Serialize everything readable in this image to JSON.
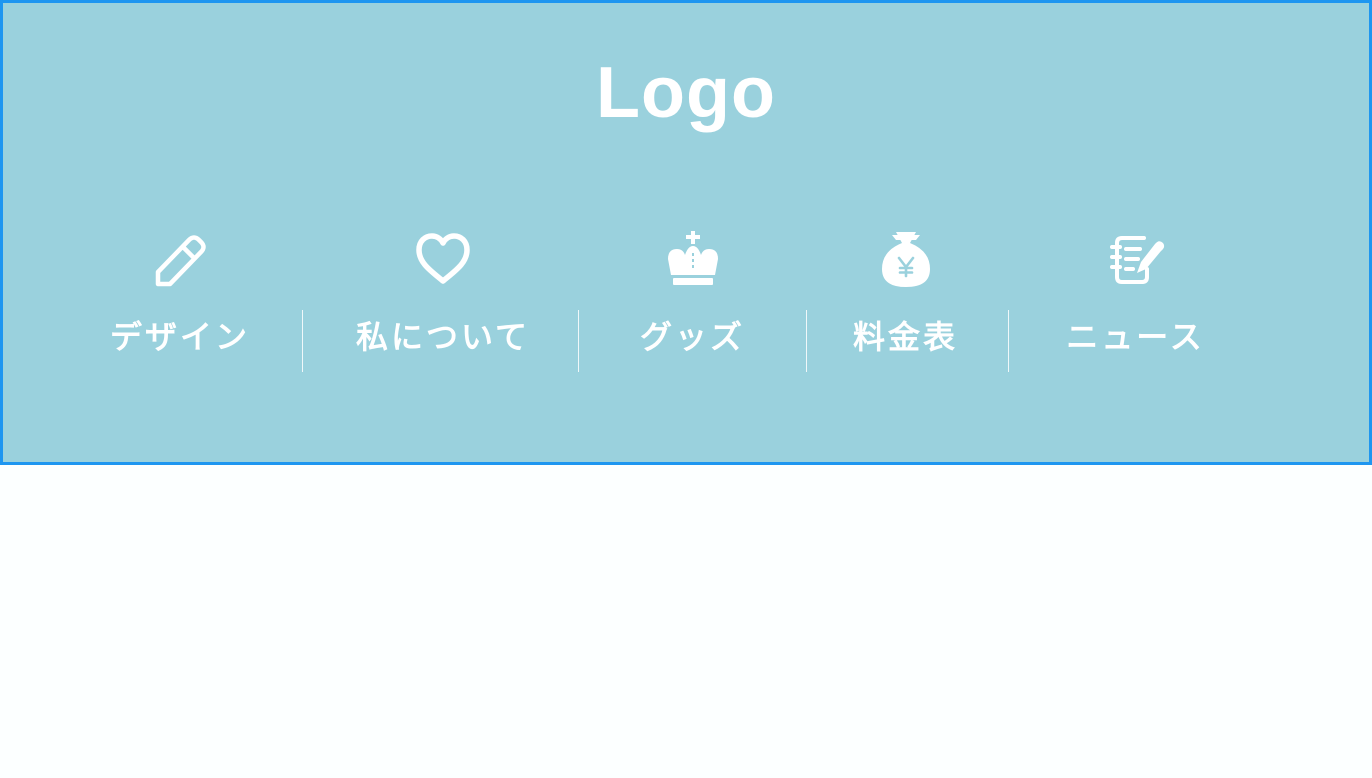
{
  "header": {
    "logo": "Logo",
    "background_color": "#9ad1dd",
    "border_color": "#1e96f0"
  },
  "nav": {
    "items": [
      {
        "label": "デザイン",
        "icon": "pencil-icon"
      },
      {
        "label": "私について",
        "icon": "heart-icon"
      },
      {
        "label": "グッズ",
        "icon": "crown-icon"
      },
      {
        "label": "料金表",
        "icon": "money-bag-yen-icon"
      },
      {
        "label": "ニュース",
        "icon": "notepad-pen-icon"
      }
    ]
  },
  "page_background": "#fcffff"
}
